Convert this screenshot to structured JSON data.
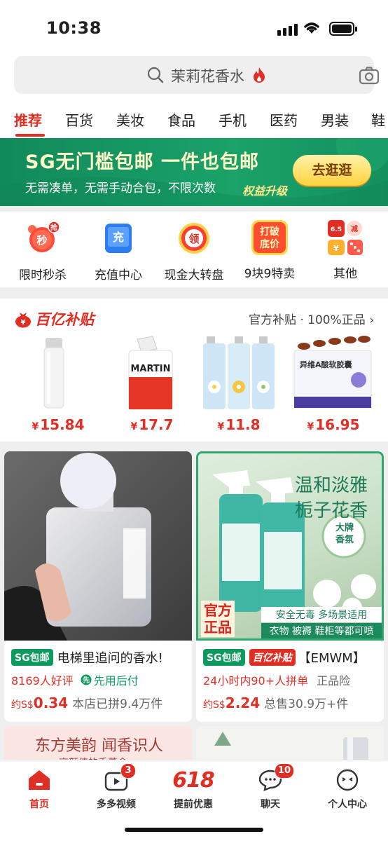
{
  "status": {
    "time": "10:38"
  },
  "search": {
    "query": "茉莉花香水"
  },
  "tabs": [
    "推荐",
    "百货",
    "美妆",
    "食品",
    "手机",
    "医药",
    "男装",
    "鞋"
  ],
  "banner": {
    "title": "SG无门槛包邮 一件也包邮",
    "subtitle": "无需凑单，无需手动合包，不限次数",
    "tag": "权益升级",
    "button": "去逛逛"
  },
  "shortcuts": [
    {
      "label": "限时秒杀",
      "icon": "alarm-clock-icon",
      "badge": "抢",
      "glyph": "秒"
    },
    {
      "label": "充值中心",
      "icon": "recharge-icon",
      "glyph": "充"
    },
    {
      "label": "现金大转盘",
      "icon": "lucky-wheel-icon",
      "glyph": "领"
    },
    {
      "label": "9块9特卖",
      "icon": "sale-icon",
      "glyph": "打破底价"
    },
    {
      "label": "其他",
      "icon": "more-grid-icon"
    }
  ],
  "subsidy": {
    "title": "百亿补贴",
    "more": "官方补贴 · 100%正品",
    "products": [
      {
        "name": "white-spray-bottle",
        "price": "15.84"
      },
      {
        "name": "martin-cream",
        "price": "17.7"
      },
      {
        "name": "perfume-set",
        "price": "11.8"
      },
      {
        "name": "retinol-softgels",
        "price": "16.95"
      }
    ],
    "currency": "¥"
  },
  "cards": [
    {
      "tag": "SG包邮",
      "title": "电梯里追问的香水!",
      "reviews": "8169人好评",
      "perk": "先用后付",
      "price_prefix": "约S$",
      "price": "0.34",
      "sold": "本店已拼9.4万件"
    },
    {
      "tag": "SG包邮",
      "tag2": "百亿补贴",
      "title": "【EMWM】",
      "group": "24小时内90+人拼单",
      "extra": "正品险",
      "price_prefix": "约S$",
      "price": "2.24",
      "sold": "总售30.9万+件",
      "overlay": {
        "headline1": "温和淡雅",
        "headline2": "栀子花香",
        "badge1": "官方",
        "badge2": "正品",
        "line1": "安全无毒 多场景适用",
        "line2": "衣物 被褥 鞋柜等都可喷",
        "stamp1": "大牌",
        "stamp2": "香氛"
      }
    }
  ],
  "peek": {
    "line1": "东方美韵 闻香识人",
    "line2": "高颜值的香薰盒"
  },
  "nav": [
    {
      "label": "首页",
      "icon": "home-icon"
    },
    {
      "label": "多多视频",
      "icon": "video-icon",
      "badge": "3"
    },
    {
      "label": "提前优惠",
      "icon": "618-icon",
      "mark": "618"
    },
    {
      "label": "聊天",
      "icon": "chat-icon",
      "badge": "10"
    },
    {
      "label": "个人中心",
      "icon": "profile-icon"
    }
  ],
  "colors": {
    "accent": "#e02e24",
    "green": "#0d9a5f",
    "banner": "#1aa269"
  }
}
